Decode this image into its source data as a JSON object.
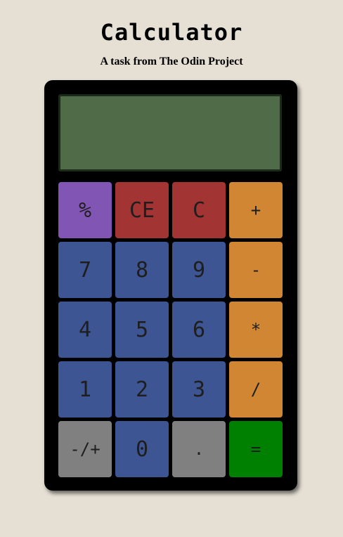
{
  "header": {
    "title": "Calculator",
    "subtitle": "A task from The Odin Project"
  },
  "display": {
    "value": ""
  },
  "colors": {
    "background": "#e5dfd4",
    "display": "#4f6b48",
    "number_key": "#3e5594",
    "operator_key": "#d08632",
    "clear_key": "#a33434",
    "percent_key": "#8155b4",
    "misc_key": "#808080",
    "equals_key": "#008000"
  },
  "keys": [
    {
      "name": "percent-button",
      "label": "%",
      "kind": "percent"
    },
    {
      "name": "clear-entry-button",
      "label": "CE",
      "kind": "clear"
    },
    {
      "name": "clear-button",
      "label": "C",
      "kind": "clear"
    },
    {
      "name": "add-button",
      "label": "+",
      "kind": "operator"
    },
    {
      "name": "digit-7-button",
      "label": "7",
      "kind": "number"
    },
    {
      "name": "digit-8-button",
      "label": "8",
      "kind": "number"
    },
    {
      "name": "digit-9-button",
      "label": "9",
      "kind": "number"
    },
    {
      "name": "subtract-button",
      "label": "-",
      "kind": "operator"
    },
    {
      "name": "digit-4-button",
      "label": "4",
      "kind": "number"
    },
    {
      "name": "digit-5-button",
      "label": "5",
      "kind": "number"
    },
    {
      "name": "digit-6-button",
      "label": "6",
      "kind": "number"
    },
    {
      "name": "multiply-button",
      "label": "*",
      "kind": "operator"
    },
    {
      "name": "digit-1-button",
      "label": "1",
      "kind": "number"
    },
    {
      "name": "digit-2-button",
      "label": "2",
      "kind": "number"
    },
    {
      "name": "digit-3-button",
      "label": "3",
      "kind": "number"
    },
    {
      "name": "divide-button",
      "label": "/",
      "kind": "operator"
    },
    {
      "name": "negate-button",
      "label": "-/+",
      "kind": "misc"
    },
    {
      "name": "digit-0-button",
      "label": "0",
      "kind": "number"
    },
    {
      "name": "decimal-button",
      "label": ".",
      "kind": "misc"
    },
    {
      "name": "equals-button",
      "label": "=",
      "kind": "equals"
    }
  ]
}
